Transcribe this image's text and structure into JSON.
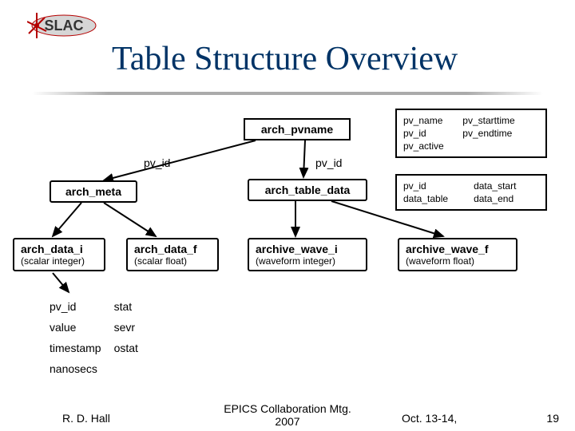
{
  "title": "Table Structure Overview",
  "nodes": {
    "arch_pvname": "arch_pvname",
    "arch_meta": "arch_meta",
    "arch_table_data": "arch_table_data",
    "arch_data_i": "arch_data_i",
    "arch_data_i_sub": "(scalar integer)",
    "arch_data_f": "arch_data_f",
    "arch_data_f_sub": "(scalar float)",
    "archive_wave_i": "archive_wave_i",
    "archive_wave_i_sub": "(waveform integer)",
    "archive_wave_f": "archive_wave_f",
    "archive_wave_f_sub": "(waveform float)"
  },
  "edge_labels": {
    "pv_id_left": "pv_id",
    "pv_id_right": "pv_id"
  },
  "side_tables": {
    "pvname": [
      [
        "pv_name",
        "pv_starttime"
      ],
      [
        "pv_id",
        "pv_endtime"
      ],
      [
        "pv_active",
        ""
      ]
    ],
    "tabledata": [
      [
        "pv_id",
        "data_start"
      ],
      [
        "data_table",
        "data_end"
      ]
    ]
  },
  "meta_fields": [
    [
      "pv_id",
      "stat"
    ],
    [
      "value",
      "sevr"
    ],
    [
      "timestamp",
      "ostat"
    ],
    [
      "nanosecs",
      ""
    ]
  ],
  "footer": {
    "author": "R. D. Hall",
    "meeting": "EPICS Collaboration Mtg.\n2007",
    "date": "Oct. 13-14,",
    "page": "19"
  }
}
